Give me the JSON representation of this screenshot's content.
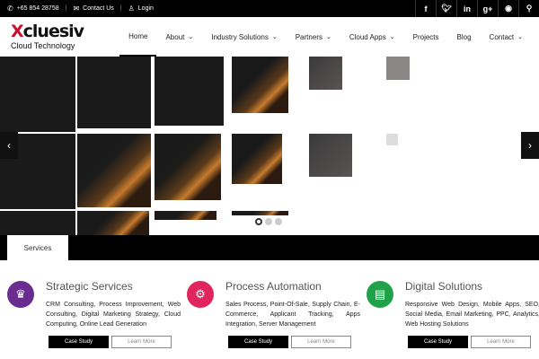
{
  "topbar": {
    "phone": "+65 854 28758",
    "contact": "Contact Us",
    "login": "Login",
    "social": [
      "f",
      "t",
      "in",
      "g+",
      "rss",
      "q"
    ]
  },
  "logo": {
    "brand_a": "X",
    "brand_b": "clue",
    "brand_c": "siv",
    "tagline": "Cloud Technology"
  },
  "nav": {
    "home": "Home",
    "about": "About",
    "industry": "Industry Solutions",
    "partners": "Partners",
    "cloud": "Cloud Apps",
    "projects": "Projects",
    "blog": "Blog",
    "contact": "Contact"
  },
  "slider": {
    "prev": "‹",
    "next": "›"
  },
  "tabs": {
    "services": "Services"
  },
  "services": [
    {
      "title": "Strategic Services",
      "desc": "CRM Consulting, Process Improvement, Web Consulting, Digital Marketing Strategy, Cloud Computing, Online Lead Generation",
      "icon": "crown-icon",
      "color": "#6a2c91",
      "primary": "Case Study",
      "secondary": "Learn More"
    },
    {
      "title": "Process Automation",
      "desc": "Sales Process, Point-Of-Sale, Supply Chain, E-Commerce, Applicant Tracking, Apps Integration, Server Management",
      "icon": "gears-icon",
      "color": "#e0245e",
      "primary": "Case Study",
      "secondary": "Learn More"
    },
    {
      "title": "Digital Solutions",
      "desc": "Responsive Web Design, Mobile Apps, SEO, Social Media, Email Marketing, PPC, Analytics, Web Hosting Solutions",
      "icon": "chart-icon",
      "color": "#1fa24a",
      "primary": "Case Study",
      "secondary": "Learn More"
    }
  ]
}
